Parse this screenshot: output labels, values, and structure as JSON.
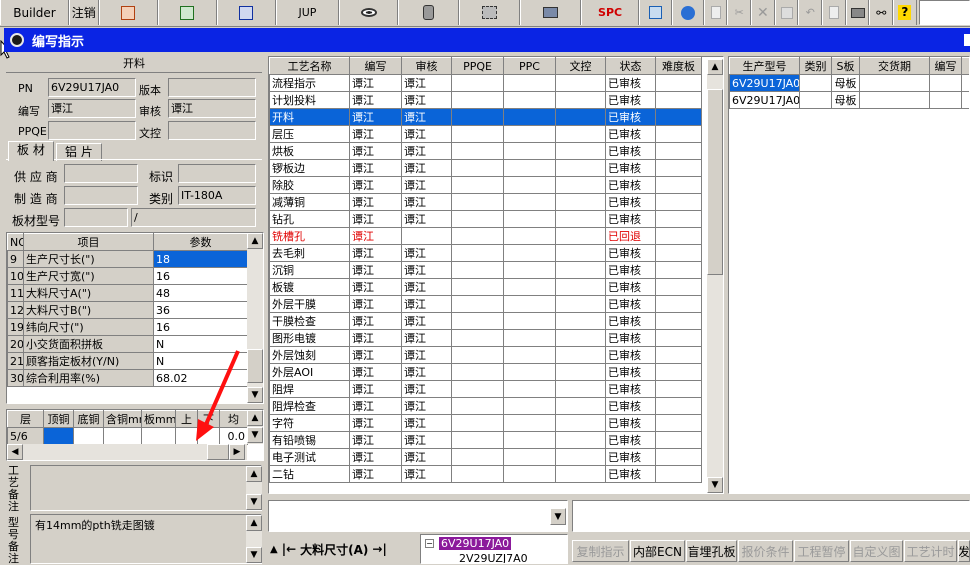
{
  "toolbar": {
    "app_label": "Builder",
    "logout_label": "注销",
    "jup_label": "JUP",
    "spc_label": "SPC"
  },
  "window": {
    "title": "编写指示"
  },
  "left": {
    "section_title": "开料",
    "pn_label": "PN",
    "pn_value": "6V29U17JA0",
    "version_label": "版本",
    "version_value": "",
    "author_label": "编写",
    "author_value": "谭江",
    "reviewer_label": "审核",
    "reviewer_value": "谭江",
    "ppqe_label": "PPQE",
    "ppqe_value": "",
    "doc_control_label": "文控",
    "doc_control_value": "",
    "tabs": [
      "板 材",
      "铝 片"
    ],
    "supplier_label": "供 应 商",
    "supplier_value": "",
    "mark_label": "标识",
    "mark_value": "",
    "manufacturer_label": "制 造 商",
    "manufacturer_value": "",
    "category_label": "类别",
    "category_value": "IT-180A",
    "material_model_label": "板材型号",
    "material_model_value": "",
    "material_model_suffix": "/",
    "param_table": {
      "headers": [
        "NO",
        "项目",
        "参数"
      ],
      "rows": [
        {
          "no": "9",
          "item": "生产尺寸长(\")",
          "param": "18",
          "selected": true
        },
        {
          "no": "10",
          "item": "生产尺寸宽(\")",
          "param": "16",
          "selected": false
        },
        {
          "no": "11",
          "item": "大料尺寸A(\")",
          "param": "48",
          "selected": false
        },
        {
          "no": "12",
          "item": "大料尺寸B(\")",
          "param": "36",
          "selected": false
        },
        {
          "no": "19",
          "item": "纬向尺寸(\")",
          "param": "16",
          "selected": false
        },
        {
          "no": "20",
          "item": "小交货面积拼板",
          "param": "N",
          "selected": false
        },
        {
          "no": "21",
          "item": "顾客指定板材(Y/N)",
          "param": "N",
          "selected": false
        },
        {
          "no": "30",
          "item": "综合利用率(%)",
          "param": "68.02",
          "selected": false
        }
      ]
    },
    "layer_table": {
      "headers": [
        "层",
        "顶铜",
        "底铜",
        "含铜mm",
        "板mm",
        "上",
        "下",
        "均"
      ],
      "row": [
        "5/6",
        "",
        "",
        "",
        "",
        "",
        "",
        "0.0"
      ]
    },
    "process_note_label": "工艺备注",
    "process_note_value": "",
    "model_note_label": "型号备注",
    "model_note_value": "有14mm的pth铣走图镀"
  },
  "center": {
    "headers": [
      "工艺名称",
      "编写",
      "审核",
      "PPQE",
      "PPC",
      "文控",
      "状态",
      "难度板"
    ],
    "rows": [
      {
        "name": "流程指示",
        "author": "谭江",
        "reviewer": "谭江",
        "status": "已审核",
        "style": "normal"
      },
      {
        "name": "计划投料",
        "author": "谭江",
        "reviewer": "谭江",
        "status": "已审核",
        "style": "normal"
      },
      {
        "name": "开料",
        "author": "谭江",
        "reviewer": "谭江",
        "status": "已审核",
        "style": "selected"
      },
      {
        "name": "层压",
        "author": "谭江",
        "reviewer": "谭江",
        "status": "已审核",
        "style": "normal"
      },
      {
        "name": "烘板",
        "author": "谭江",
        "reviewer": "谭江",
        "status": "已审核",
        "style": "normal"
      },
      {
        "name": "锣板边",
        "author": "谭江",
        "reviewer": "谭江",
        "status": "已审核",
        "style": "normal"
      },
      {
        "name": "除胶",
        "author": "谭江",
        "reviewer": "谭江",
        "status": "已审核",
        "style": "normal"
      },
      {
        "name": "减薄铜",
        "author": "谭江",
        "reviewer": "谭江",
        "status": "已审核",
        "style": "normal"
      },
      {
        "name": "钻孔",
        "author": "谭江",
        "reviewer": "谭江",
        "status": "已审核",
        "style": "normal"
      },
      {
        "name": "铣槽孔",
        "author": "谭江",
        "reviewer": "",
        "status": "已回退",
        "style": "red"
      },
      {
        "name": "去毛刺",
        "author": "谭江",
        "reviewer": "谭江",
        "status": "已审核",
        "style": "normal"
      },
      {
        "name": "沉铜",
        "author": "谭江",
        "reviewer": "谭江",
        "status": "已审核",
        "style": "normal"
      },
      {
        "name": "板镀",
        "author": "谭江",
        "reviewer": "谭江",
        "status": "已审核",
        "style": "normal"
      },
      {
        "name": "外层干膜",
        "author": "谭江",
        "reviewer": "谭江",
        "status": "已审核",
        "style": "normal"
      },
      {
        "name": "干膜检查",
        "author": "谭江",
        "reviewer": "谭江",
        "status": "已审核",
        "style": "normal"
      },
      {
        "name": "图形电镀",
        "author": "谭江",
        "reviewer": "谭江",
        "status": "已审核",
        "style": "normal"
      },
      {
        "name": "外层蚀刻",
        "author": "谭江",
        "reviewer": "谭江",
        "status": "已审核",
        "style": "normal"
      },
      {
        "name": "外层AOI",
        "author": "谭江",
        "reviewer": "谭江",
        "status": "已审核",
        "style": "normal"
      },
      {
        "name": "阻焊",
        "author": "谭江",
        "reviewer": "谭江",
        "status": "已审核",
        "style": "normal"
      },
      {
        "name": "阻焊检查",
        "author": "谭江",
        "reviewer": "谭江",
        "status": "已审核",
        "style": "normal"
      },
      {
        "name": "字符",
        "author": "谭江",
        "reviewer": "谭江",
        "status": "已审核",
        "style": "normal"
      },
      {
        "name": "有铅喷锡",
        "author": "谭江",
        "reviewer": "谭江",
        "status": "已审核",
        "style": "normal"
      },
      {
        "name": "电子测试",
        "author": "谭江",
        "reviewer": "谭江",
        "status": "已审核",
        "style": "normal"
      },
      {
        "name": "二钻",
        "author": "谭江",
        "reviewer": "谭江",
        "status": "已审核",
        "style": "normal"
      }
    ],
    "dimension_label": "大料尺寸(A)",
    "tree_root": "6V29U17JA0",
    "tree_child": "2V29UZJ7A0"
  },
  "right": {
    "headers": [
      "生产型号",
      "类别",
      "S板",
      "交货期",
      "编写",
      "审"
    ],
    "rows": [
      {
        "model": "6V29U17JA0",
        "category": "",
        "sboard": "母板",
        "delivery": "",
        "author": "",
        "selected": true
      },
      {
        "model": "6V29U17JA0",
        "category": "",
        "sboard": "母板",
        "delivery": "",
        "author": "",
        "selected": false
      }
    ]
  },
  "bottom_buttons": [
    "复制指示",
    "内部ECN",
    "盲埋孔板",
    "报价条件",
    "工程暂停",
    "自定义图",
    "工艺计时",
    "发"
  ],
  "bottom_buttons_enabled": [
    false,
    true,
    true,
    false,
    false,
    false,
    false,
    true
  ]
}
